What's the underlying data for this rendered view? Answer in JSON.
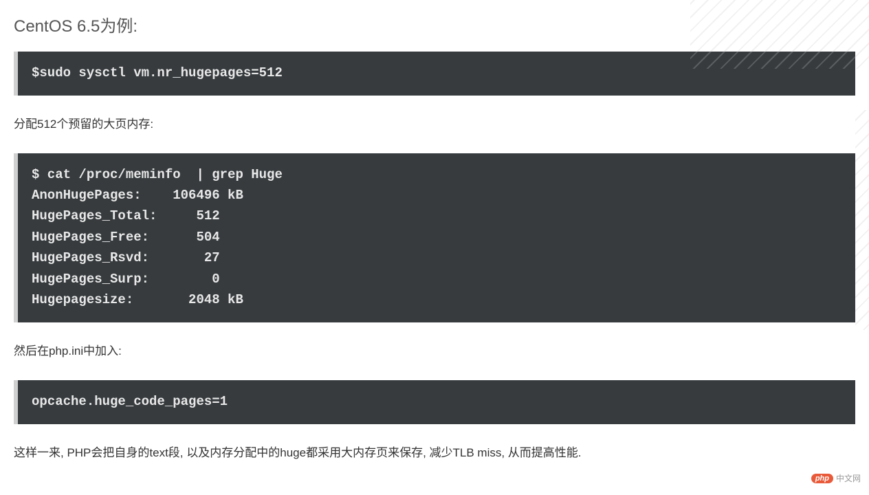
{
  "heading": "CentOS 6.5为例:",
  "code1": "$sudo sysctl vm.nr_hugepages=512",
  "para1": "分配512个预留的大页内存:",
  "code2": "$ cat /proc/meminfo  | grep Huge\nAnonHugePages:    106496 kB\nHugePages_Total:     512\nHugePages_Free:      504\nHugePages_Rsvd:       27\nHugePages_Surp:        0\nHugepagesize:       2048 kB",
  "para2": "然后在php.ini中加入:",
  "code3": "opcache.huge_code_pages=1",
  "para3": "这样一来, PHP会把自身的text段, 以及内存分配中的huge都采用大内存页来保存, 减少TLB miss, 从而提高性能.",
  "watermark": {
    "badge": "php",
    "text": "中文网"
  }
}
